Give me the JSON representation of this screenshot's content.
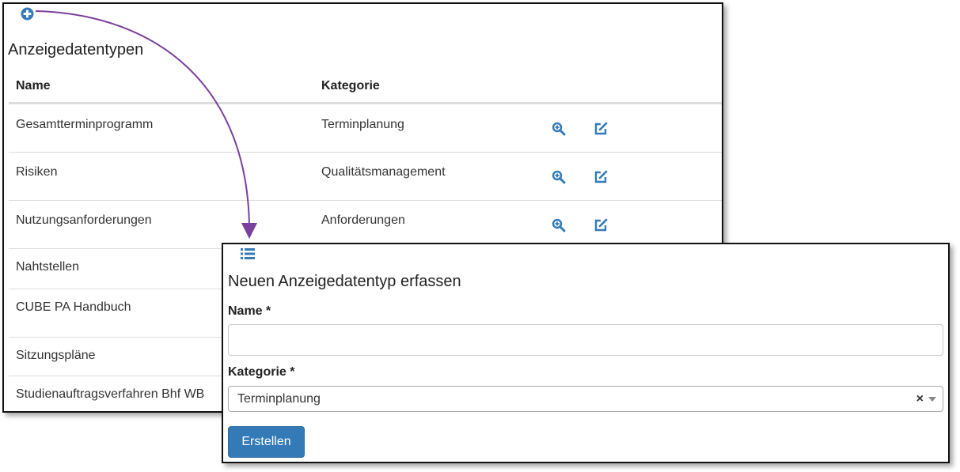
{
  "colors": {
    "accent": "#337ab7",
    "arrow": "#7b3f9e"
  },
  "list_panel": {
    "add_icon": "plus-circle-icon",
    "title": "Anzeigedatentypen",
    "columns": {
      "name": "Name",
      "category": "Kategorie"
    },
    "rows": [
      {
        "name": "Gesamtterminprogramm",
        "category": "Terminplanung",
        "actions": [
          "zoom-in-icon",
          "edit-icon"
        ]
      },
      {
        "name": "Risiken",
        "category": "Qualitätsmanagement",
        "actions": [
          "zoom-in-icon",
          "edit-icon"
        ]
      },
      {
        "name": "Nutzungsanforderungen",
        "category": "Anforderungen",
        "actions": [
          "zoom-in-icon",
          "edit-icon"
        ]
      },
      {
        "name": "Nahtstellen"
      },
      {
        "name": "CUBE PA Handbuch"
      },
      {
        "name": "Sitzungspläne"
      },
      {
        "name": "Studienauftragsverfahren Bhf WB"
      }
    ]
  },
  "form_panel": {
    "list_icon": "list-icon",
    "title": "Neuen Anzeigedatentyp erfassen",
    "name_label": "Name *",
    "name_value": "",
    "category_label": "Kategorie *",
    "category_value": "Terminplanung",
    "clear_glyph": "×",
    "submit_label": "Erstellen"
  }
}
